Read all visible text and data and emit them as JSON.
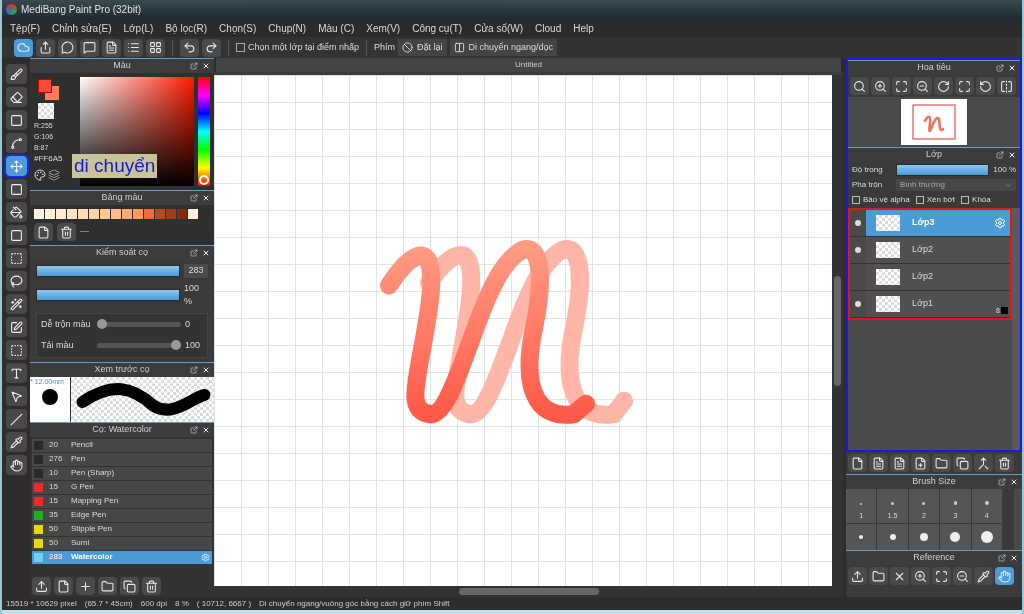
{
  "window": {
    "title": "MediBang Paint Pro (32bit)"
  },
  "menu": [
    "Tệp(F)",
    "Chỉnh sửa(E)",
    "Lớp(L)",
    "Bộ lọc(R)",
    "Chọn(S)",
    "Chụp(N)",
    "Màu (C)",
    "Xem(V)",
    "Công cụ(T)",
    "Cửa sổ(W)",
    "Cloud",
    "Help"
  ],
  "toolbar": {
    "pick_layer": {
      "label": "Chọn một lớp tại điểm nhấp",
      "checked": false
    },
    "key_label": "Phím",
    "reset_button": "Đặt lại",
    "move_button": "Di chuyển ngang/dọc"
  },
  "tools": [
    {
      "kind": "brush",
      "selected": false
    },
    {
      "kind": "eraser",
      "selected": false
    },
    {
      "kind": "dot",
      "selected": false
    },
    {
      "kind": "curve",
      "selected": false
    },
    {
      "kind": "move",
      "selected": true
    },
    {
      "kind": "fill",
      "selected": false
    },
    {
      "kind": "bucket",
      "selected": false
    },
    {
      "kind": "gradient",
      "selected": false
    },
    {
      "kind": "select",
      "selected": false
    },
    {
      "kind": "lasso",
      "selected": false
    },
    {
      "kind": "wand",
      "selected": false
    },
    {
      "kind": "selectpen",
      "selected": false
    },
    {
      "kind": "selecteraser",
      "selected": false
    },
    {
      "kind": "text",
      "selected": false
    },
    {
      "kind": "operation",
      "selected": false
    },
    {
      "kind": "divide",
      "selected": false
    },
    {
      "kind": "eyedropper",
      "selected": false
    },
    {
      "kind": "hand",
      "selected": false
    }
  ],
  "annotation": "di chuyển",
  "color_panel": {
    "title": "Màu",
    "r": "R:255",
    "g": "G:106",
    "b": "B:87",
    "hex": "#FF6A5"
  },
  "palette_panel": {
    "title": "Bảng màu",
    "swatches": [
      {
        "color": "#fff4e6"
      },
      {
        "color": "#fff0dc"
      },
      {
        "color": "#ffead0"
      },
      {
        "color": "#ffe4c4"
      },
      {
        "color": "#ffdcb4"
      },
      {
        "color": "#ffd4a4"
      },
      {
        "color": "#ffc894"
      },
      {
        "color": "#ffbc84"
      },
      {
        "color": "#ffa870"
      },
      {
        "color": "#ff9858"
      },
      {
        "color": "#f06a40"
      },
      {
        "color": "#b84a18"
      },
      {
        "color": "#9c4018"
      },
      {
        "color": "#7c3010"
      },
      {
        "color": "#fff2d8"
      }
    ],
    "separator": "—"
  },
  "brush_control": {
    "title": "Kiểm soát cọ",
    "size": {
      "level": 1,
      "value": "283"
    },
    "opacity": {
      "level": 1,
      "value": "100 %"
    },
    "sliders": [
      {
        "label": "Dễ trộn màu",
        "level": 0,
        "value": "0"
      },
      {
        "label": "Tải màu",
        "level": 1,
        "value": "100"
      }
    ]
  },
  "brush_preview": {
    "title": "Xem trước cọ",
    "size": "* 12.00mm"
  },
  "brush_list": {
    "title": "Cọ: Watercolor",
    "items": [
      {
        "size": "20",
        "name": "Pencil",
        "color": "#2a2a2a",
        "selected": false
      },
      {
        "size": "276",
        "name": "Pen",
        "color": "#2a2a2a",
        "selected": false
      },
      {
        "size": "10",
        "name": "Pen (Sharp)",
        "color": "#2a2a2a",
        "selected": false
      },
      {
        "size": "15",
        "name": "G Pen",
        "color": "#ee2a2a",
        "selected": false
      },
      {
        "size": "15",
        "name": "Mapping Pen",
        "color": "#ee2a2a",
        "selected": false
      },
      {
        "size": "35",
        "name": "Edge Pen",
        "color": "#1eb01e",
        "selected": false
      },
      {
        "size": "50",
        "name": "Stipple Pen",
        "color": "#e8d818",
        "selected": false
      },
      {
        "size": "50",
        "name": "Sumi",
        "color": "#e8d818",
        "selected": false
      },
      {
        "size": "283",
        "name": "Watercolor",
        "color": "#6ed0f5",
        "selected": true
      }
    ]
  },
  "canvas": {
    "tab": "Untitled"
  },
  "navigator": {
    "title": "Hoa tiêu"
  },
  "layers": {
    "title": "Lớp",
    "opacity_label": "Độ trong",
    "opacity": {
      "level": 1,
      "value": "100 %"
    },
    "blend_label": "Pha trộn",
    "blend": "Bình thường",
    "options": [
      {
        "label": "Bảo vệ alpha",
        "checked": false
      },
      {
        "label": "Xén bớt",
        "checked": false
      },
      {
        "label": "Khóa",
        "checked": false
      }
    ],
    "items": [
      {
        "name": "Lớp3",
        "visible": true,
        "selected": true
      },
      {
        "name": "Lớp2",
        "visible": true,
        "selected": false
      },
      {
        "name": "Lớp2",
        "visible": false,
        "selected": false
      },
      {
        "name": "Lớp1",
        "visible": true,
        "selected": false,
        "badge": "8"
      }
    ]
  },
  "brush_size": {
    "title": "Brush Size",
    "sizes": [
      "1",
      "1.5",
      "2",
      "3",
      "4"
    ]
  },
  "reference": {
    "title": "Reference"
  },
  "status_bar": [
    "15519 * 10629 pixel",
    "(65.7 * 45cm)",
    "600 dpi",
    "8 %",
    "( 10712, 6667 )",
    "Di chuyển ngang/vuông góc bằng cách giữ phím Shift"
  ]
}
